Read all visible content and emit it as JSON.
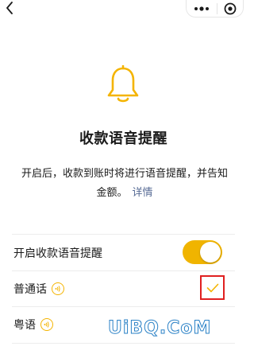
{
  "nav": {
    "back_icon": "chevron-left-icon",
    "more_icon": "more-dots-icon",
    "close_icon": "target-close-icon"
  },
  "hero": {
    "icon": "bell-icon",
    "color": "#f4b400"
  },
  "title": "收款语音提醒",
  "description": "开启后，收款到账时将进行语音提醒，并告知金额。",
  "detail_link": "详情",
  "settings": {
    "voice_toggle_label": "开启收款语音提醒",
    "voice_toggle_on": true,
    "languages": [
      {
        "label": "普通话",
        "selected": true
      },
      {
        "label": "粤语",
        "selected": false
      }
    ]
  },
  "colors": {
    "accent": "#f4b400",
    "toggle": "#f0b400",
    "link": "#576b95",
    "highlight": "#e02020"
  },
  "watermark": "UiBQ.CoM"
}
